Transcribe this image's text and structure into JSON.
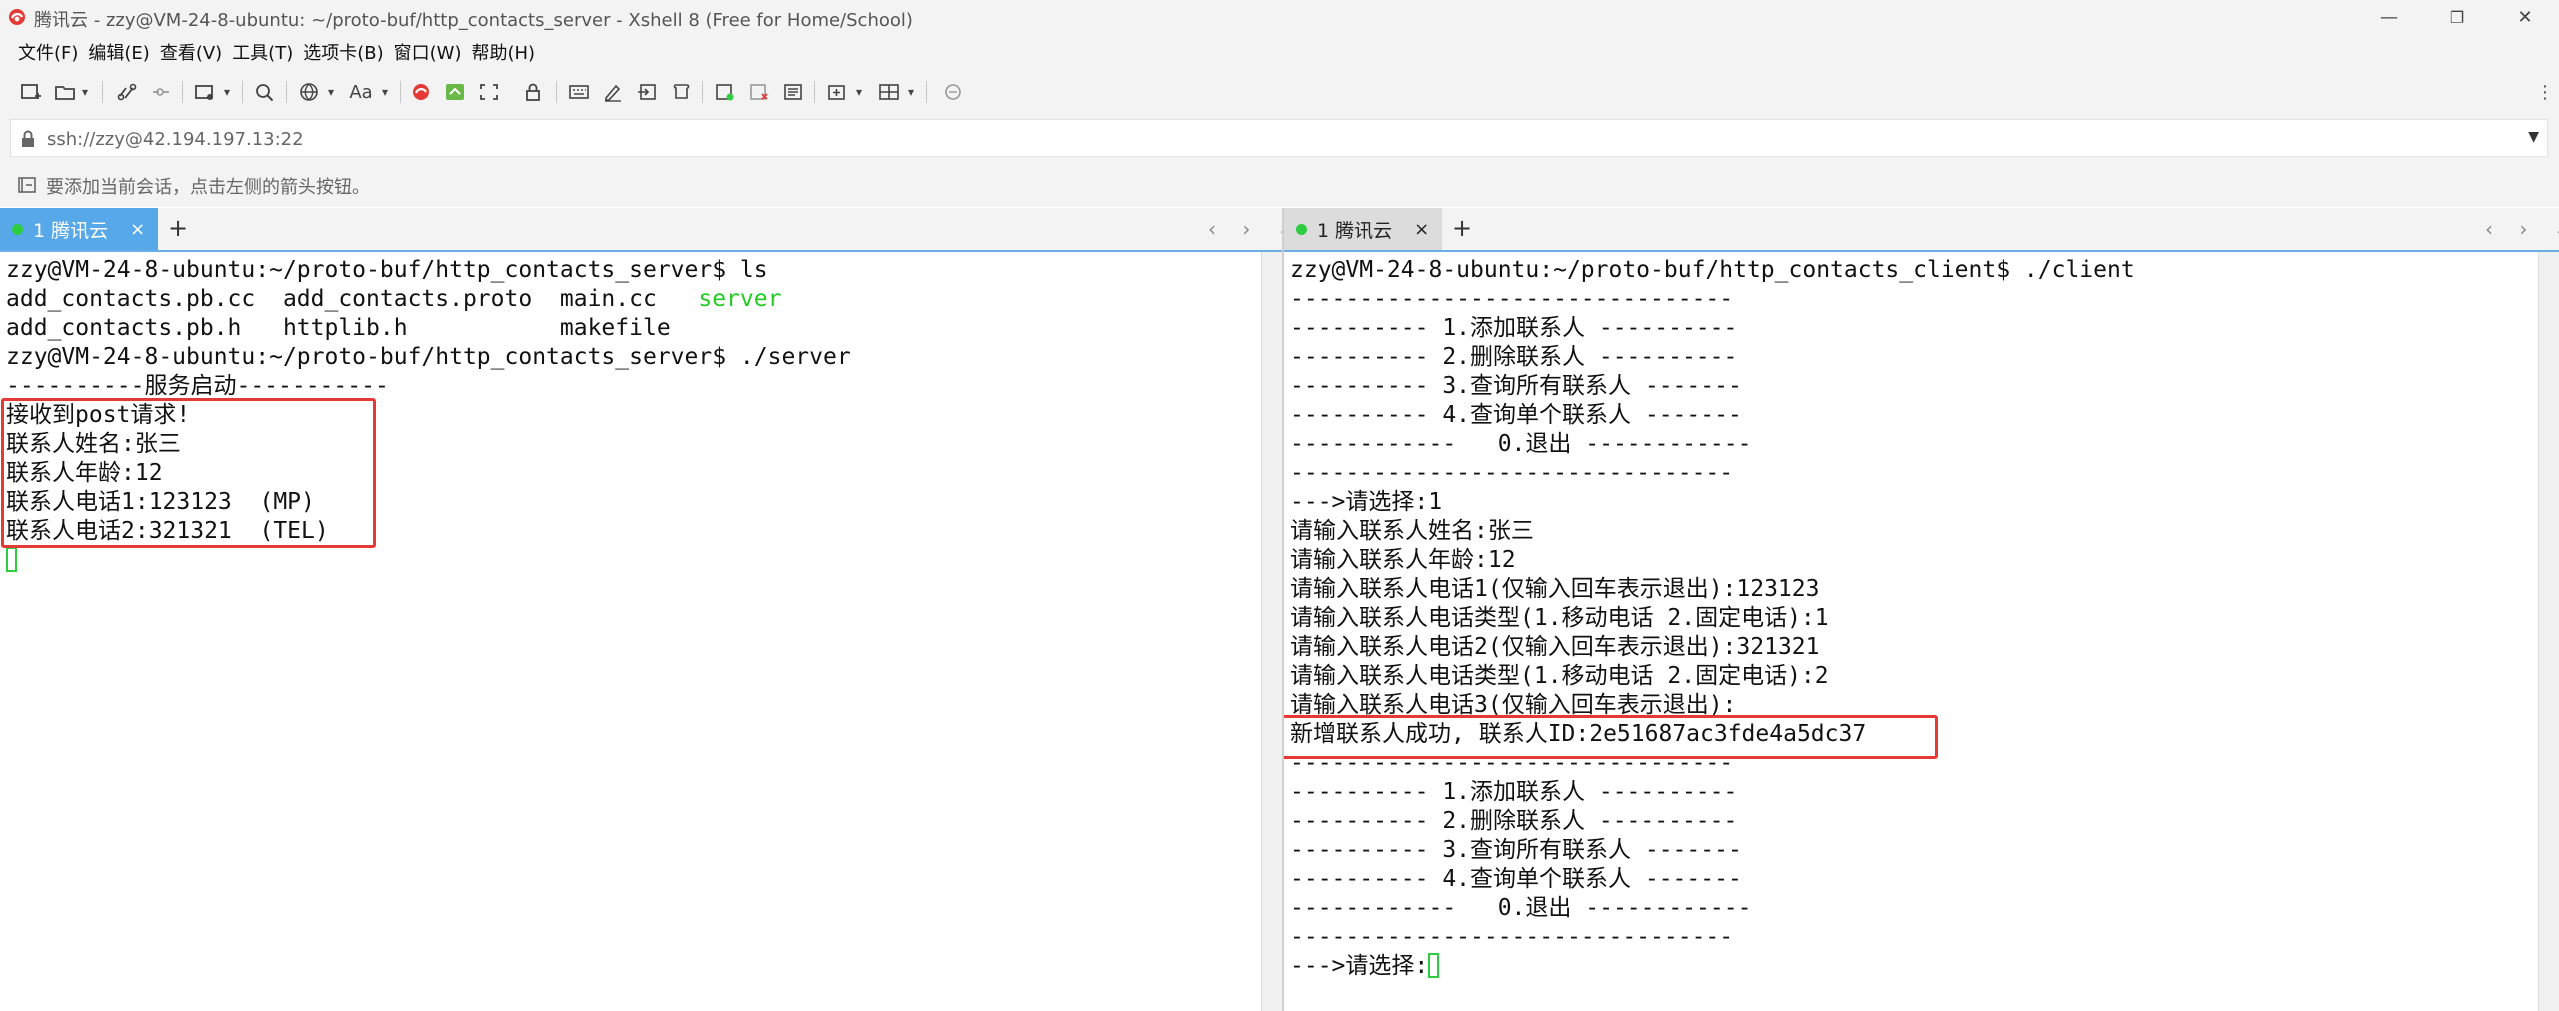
{
  "window": {
    "title": "腾讯云 - zzy@VM-24-8-ubuntu: ~/proto-buf/http_contacts_server - Xshell 8 (Free for Home/School)",
    "minimize": "—",
    "maximize": "❐",
    "close": "✕"
  },
  "menu": [
    "文件(F)",
    "编辑(E)",
    "查看(V)",
    "工具(T)",
    "选项卡(B)",
    "窗口(W)",
    "帮助(H)"
  ],
  "toolbar": {
    "font_label": "Aa"
  },
  "address": {
    "value": "ssh://zzy@42.194.197.13:22",
    "dropdown": "▼"
  },
  "hint": {
    "text": "要添加当前会话，点击左侧的箭头按钮。"
  },
  "left_pane": {
    "tab": {
      "label": "1 腾讯云",
      "close": "×",
      "active": true
    },
    "plus": "+",
    "nav": "‹ › ⌄",
    "lines": [
      {
        "text": "zzy@VM-24-8-ubuntu:~/proto-buf/http_contacts_server$ ls"
      },
      {
        "parts": [
          "add_contacts.pb.cc  add_contacts.proto  main.cc   ",
          "server"
        ]
      },
      {
        "text": "add_contacts.pb.h   httplib.h           makefile"
      },
      {
        "text": "zzy@VM-24-8-ubuntu:~/proto-buf/http_contacts_server$ ./server"
      },
      {
        "text": "----------服务启动-----------"
      },
      {
        "text": "接收到post请求!"
      },
      {
        "text": "联系人姓名:张三"
      },
      {
        "text": "联系人年龄:12"
      },
      {
        "text": "联系人电话1:123123  (MP)"
      },
      {
        "text": "联系人电话2:321321  (TEL)"
      }
    ]
  },
  "right_pane": {
    "tab": {
      "label": "1 腾讯云",
      "close": "×",
      "active": false
    },
    "plus": "+",
    "nav": "‹ › ⌄",
    "lines": [
      {
        "text": "zzy@VM-24-8-ubuntu:~/proto-buf/http_contacts_client$ ./client"
      },
      {
        "text": "--------------------------------"
      },
      {
        "text": "---------- 1.添加联系人 ----------"
      },
      {
        "text": "---------- 2.删除联系人 ----------"
      },
      {
        "text": "---------- 3.查询所有联系人 -------"
      },
      {
        "text": "---------- 4.查询单个联系人 -------"
      },
      {
        "text": "------------   0.退出 ------------"
      },
      {
        "text": "--------------------------------"
      },
      {
        "text": "--->请选择:1"
      },
      {
        "text": "请输入联系人姓名:张三"
      },
      {
        "text": "请输入联系人年龄:12"
      },
      {
        "text": "请输入联系人电话1(仅输入回车表示退出):123123"
      },
      {
        "text": "请输入联系人电话类型(1.移动电话 2.固定电话):1"
      },
      {
        "text": "请输入联系人电话2(仅输入回车表示退出):321321"
      },
      {
        "text": "请输入联系人电话类型(1.移动电话 2.固定电话):2"
      },
      {
        "text": "请输入联系人电话3(仅输入回车表示退出):"
      },
      {
        "text": "新增联系人成功, 联系人ID:2e51687ac3fde4a5dc37"
      },
      {
        "text": "--------------------------------"
      },
      {
        "text": "---------- 1.添加联系人 ----------"
      },
      {
        "text": "---------- 2.删除联系人 ----------"
      },
      {
        "text": "---------- 3.查询所有联系人 -------"
      },
      {
        "text": "---------- 4.查询单个联系人 -------"
      },
      {
        "text": "------------   0.退出 ------------"
      },
      {
        "text": "--------------------------------"
      },
      {
        "text": "--->请选择:"
      }
    ]
  },
  "colors": {
    "chrome_bg": "#f3f3f3",
    "active_tab": "#57a8e8",
    "inactive_tab": "#e1e1e1",
    "highlight_border": "#e53935",
    "executable_green": "#22cc22",
    "cursor_green": "#2ecc40"
  }
}
